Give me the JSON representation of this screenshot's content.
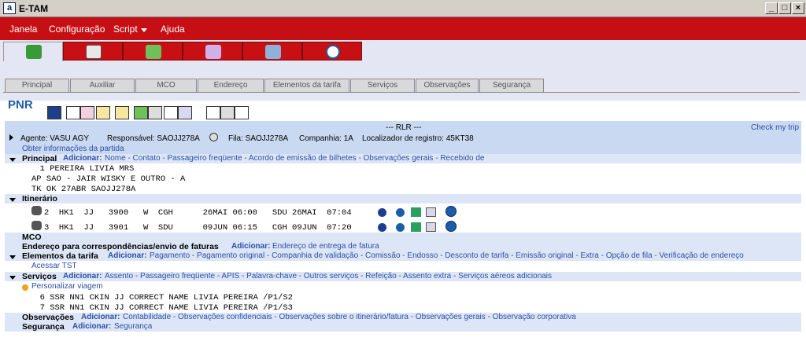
{
  "window": {
    "title": "E-TAM",
    "app_icon": "a",
    "min": "_",
    "max": "□",
    "close": "×"
  },
  "menu": [
    "Janela",
    "Configuração",
    "Script",
    "Ajuda"
  ],
  "icon_tabs": [
    "package-icon",
    "gear-robot-icon",
    "people-icon",
    "pencil-pad-icon",
    "document-icon",
    "info-icon"
  ],
  "text_tabs": [
    "Principal",
    "Auxiliar",
    "MCO",
    "Endereço",
    "Elementos da tarifa",
    "Serviços",
    "Observações",
    "Segurança"
  ],
  "pnr": {
    "title": "PNR"
  },
  "rlr": {
    "title": "--- RLR ---",
    "check": "Check my trip",
    "agent": "Agente: VASU AGY",
    "resp": "Responsável: SAOJJ278A",
    "fila": "Fila: SAOJJ278A",
    "company": "Companhia: 1A",
    "locator": "Localizador de registro: 45KT38",
    "obtain": "Obter informações da partida"
  },
  "principal": {
    "label": "Principal",
    "add": "Adicionar:",
    "links": "Nome - Contato - Passageiro freqüente - Acordo de emissão de bilhetes - Observações gerais - Recebido de",
    "l1": "  1 PEREIRA LIVIA MRS",
    "l2": "AP SAO - JAIR WISKY E OUTRO - A",
    "l3": "TK OK 27ABR SAOJJ278A"
  },
  "itinerario": {
    "label": "Itinerário",
    "s1": "2  HK1  JJ   3900   W  CGH      26MAI 06:00   SDU 26MAI  07:04",
    "s2": "3  HK1  JJ   3901   W  SDU      09JUN 06:15   CGH 09JUN  07:20"
  },
  "mco": {
    "label": "MCO"
  },
  "endereco": {
    "label": "Endereço para correspondências/envio de faturas",
    "add": "Adicionar:",
    "links": "Endereço de entrega de fatura"
  },
  "tarifa": {
    "label": "Elementos da tarifa",
    "add": "Adicionar:",
    "links": "Pagamento - Pagamento original - Companhia de validação - Comissão - Endosso - Desconto de tarifa - Emissão original - Extra - Opção de fila - Verificação de endereço",
    "tst": "Acessar TST"
  },
  "servicos": {
    "label": "Serviços",
    "add": "Adicionar:",
    "links": "Assento - Passageiro freqüente - APIS - Palavra-chave - Outros serviços - Refeição - Assento extra - Serviços aéreos adicionais",
    "personal": "Personalizar viagem",
    "l6": "  6 SSR NN1 CKIN JJ CORRECT NAME LIVIA PEREIRA /P1/S2",
    "l7": "  7 SSR NN1 CKIN JJ CORRECT NAME LIVIA PEREIRA /P1/S3"
  },
  "obs": {
    "label": "Observações",
    "add": "Adicionar:",
    "links": "Contabilidade - Observações confidenciais - Observações sobre o itinerário/fatura - Observações gerais - Observação corporativa"
  },
  "seg": {
    "label": "Segurança",
    "add": "Adicionar:",
    "links": "Segurança"
  }
}
